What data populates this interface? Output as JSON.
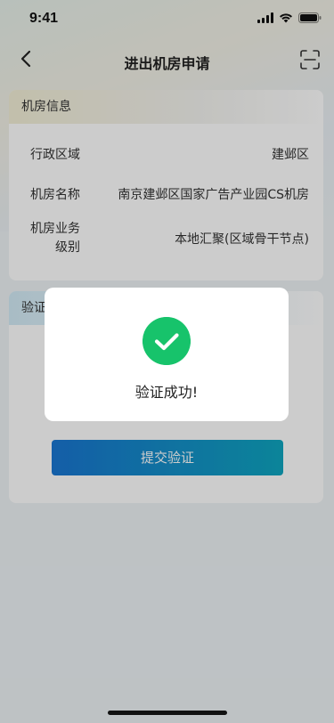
{
  "status_bar": {
    "time": "9:41"
  },
  "nav": {
    "title": "进出机房申请"
  },
  "info_card": {
    "header": "机房信息",
    "rows": [
      {
        "label": "行政区域",
        "value": "建邺区"
      },
      {
        "label": "机房名称",
        "value": "南京建邺区国家广告产业园CS机房"
      },
      {
        "label": "机房业务级别",
        "label_line1": "机房业务",
        "label_line2": "级别",
        "value": "本地汇聚(区域骨干节点)"
      }
    ]
  },
  "verify_card": {
    "header": "验证",
    "submit_label": "提交验证"
  },
  "dialog": {
    "message": "验证成功!",
    "icon": "check-circle-icon",
    "icon_color": "#17c36b"
  },
  "colors": {
    "accent_start": "#1976d2",
    "accent_end": "#0fa6c0",
    "success": "#17c36b"
  }
}
